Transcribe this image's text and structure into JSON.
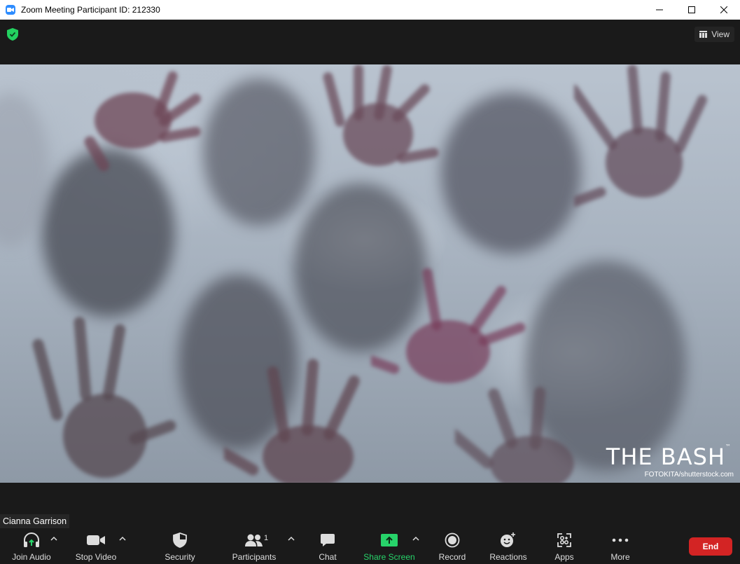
{
  "window": {
    "title": "Zoom Meeting Participant ID: 212330"
  },
  "topbar": {
    "view_label": "View"
  },
  "video": {
    "brand": "THE BASH",
    "brand_tm": "™",
    "credit": "FOTOKITA/shutterstock.com"
  },
  "participant": {
    "name": "Cianna Garrison"
  },
  "toolbar": {
    "join_audio": "Join Audio",
    "stop_video": "Stop Video",
    "security": "Security",
    "participants": "Participants",
    "participants_count": "1",
    "chat": "Chat",
    "share_screen": "Share Screen",
    "record": "Record",
    "reactions": "Reactions",
    "apps": "Apps",
    "more": "More",
    "end": "End"
  },
  "colors": {
    "accent": "#2d8cff",
    "share_green": "#27d36a",
    "end_red": "#d32424",
    "background": "#1a1a1a"
  }
}
